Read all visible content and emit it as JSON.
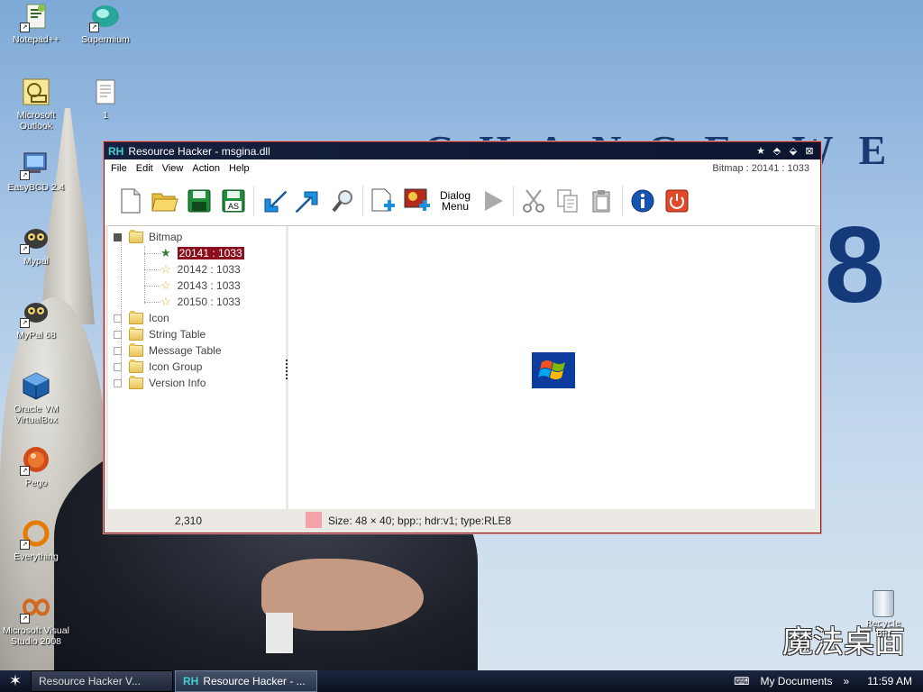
{
  "desktop": {
    "wallpaper_text": "CHANGE WE NEED",
    "wallpaper_number": "8",
    "logo_text": "魔法桌面",
    "icons": [
      {
        "label": "Notepad++",
        "icon": "notepad-plus-icon"
      },
      {
        "label": "Supermium",
        "icon": "supermium-icon"
      },
      {
        "label": "Microsoft Outlook",
        "icon": "outlook-icon"
      },
      {
        "label": "1",
        "icon": "document-icon"
      },
      {
        "label": "EasyBCD 2.4",
        "icon": "easybcd-icon"
      },
      {
        "label": "Mypal",
        "icon": "mypal-icon"
      },
      {
        "label": "MyPal 68",
        "icon": "mypal-icon"
      },
      {
        "label": "Oracle VM VirtualBox",
        "icon": "virtualbox-icon"
      },
      {
        "label": "Pego",
        "icon": "pego-icon"
      },
      {
        "label": "Everything",
        "icon": "everything-icon"
      },
      {
        "label": "Microsoft Visual Studio 2008",
        "icon": "visual-studio-icon"
      }
    ],
    "recycle_bin": "Recycle Bin"
  },
  "window": {
    "app_abbrev": "RH",
    "title": "Resource Hacker - msgina.dll",
    "menu": [
      "File",
      "Edit",
      "View",
      "Action",
      "Help"
    ],
    "menu_right": "Bitmap : 20141 : 1033",
    "toolbar": {
      "dialog_menu_line1": "Dialog",
      "dialog_menu_line2": "Menu",
      "save_as_label": "AS"
    },
    "tree": {
      "root": "Bitmap",
      "children": [
        "20141 : 1033",
        "20142 : 1033",
        "20143 : 1033",
        "20150 : 1033"
      ],
      "selected": "20141 : 1033",
      "folders": [
        "Icon",
        "String Table",
        "Message Table",
        "Icon Group",
        "Version Info"
      ]
    },
    "status": {
      "coords": "2,310",
      "info": "Size: 48 × 40;  bpp:;  hdr:v1;  type:RLE8"
    }
  },
  "taskbar": {
    "tasks": [
      "Resource Hacker V...",
      "Resource Hacker - ..."
    ],
    "tray_keyboard": "⌨",
    "tray_folder": "My Documents",
    "tray_chevron": "»",
    "clock": "11:59 AM"
  }
}
